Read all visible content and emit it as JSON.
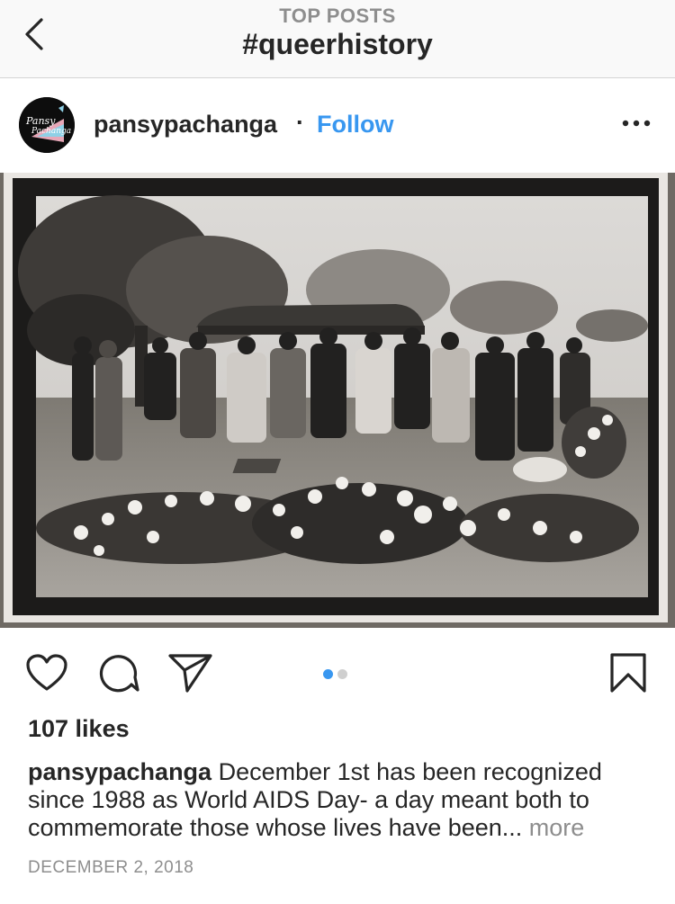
{
  "nav": {
    "kicker": "TOP POSTS",
    "title": "#queerhistory",
    "back_icon": "chevron-left-icon"
  },
  "post": {
    "username": "pansypachanga",
    "separator": "·",
    "follow_label": "Follow",
    "avatar_text": "Pansy Pachanga",
    "options_icon": "more-horizontal-icon",
    "photo_description": "Black-and-white photograph of a graveside funeral service: mourners gathered under a canopy tent beside trees, floral wreaths laid on the grass in the foreground"
  },
  "actions": {
    "like_icon": "heart-icon",
    "comment_icon": "comment-icon",
    "share_icon": "paper-plane-icon",
    "save_icon": "bookmark-icon",
    "carousel_total": 2,
    "carousel_active": 1
  },
  "likes": "107 likes",
  "caption": {
    "username": "pansypachanga",
    "text": "December 1st has been recognized since 1988 as World AIDS Day- a day meant both to commemorate those whose lives have been...",
    "more_label": "more"
  },
  "date": "DECEMBER 2, 2018",
  "colors": {
    "link_blue": "#3897f0",
    "text_primary": "#262626",
    "text_secondary": "#8e8e8e",
    "nav_bg": "#f9f9f9"
  }
}
